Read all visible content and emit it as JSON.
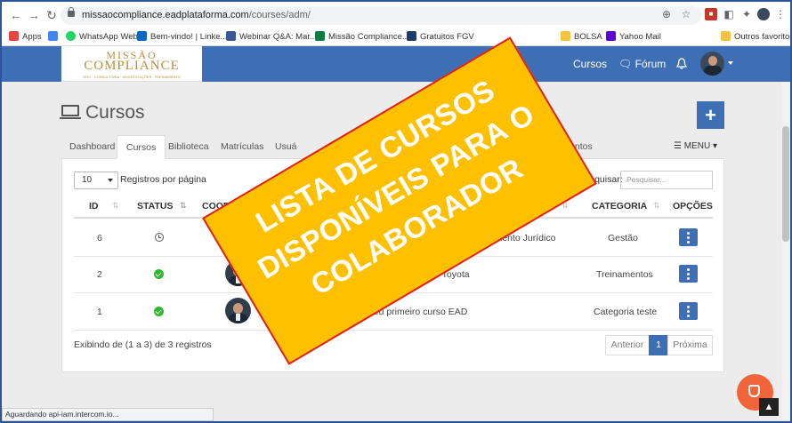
{
  "browser": {
    "url_host": "missaocompliance.eadplataforma.com",
    "url_path": "/courses/adm/",
    "bookmarks": [
      {
        "label": "Apps",
        "color": "#e8453c"
      },
      {
        "label": "",
        "color": "#4285f4"
      },
      {
        "label": "WhatsApp Web",
        "color": "#25d366"
      },
      {
        "label": "Bem-vindo! | Linke...",
        "color": "#0a66c2"
      },
      {
        "label": "Webinar Q&A: Mar...",
        "color": "#3b5998"
      },
      {
        "label": "Missão Compliance...",
        "color": "#107c41"
      },
      {
        "label": "Gratuitos FGV",
        "color": "#1d3c6e"
      },
      {
        "label": "BOLSA",
        "color": "#f5c242"
      },
      {
        "label": "Yahoo Mail",
        "color": "#6001d2"
      },
      {
        "label": "Outros favoritos",
        "color": "#f5c242"
      }
    ],
    "status": "Aguardando api-iam.intercom.io..."
  },
  "header": {
    "logo_top": "MISSÃO",
    "logo_main": "COMPLIANCE",
    "logo_sub": "GRC · CONSULTORIA · INVESTIGAÇÕES · TREINAMENTO",
    "courses_link": "Cursos",
    "forum_link": "Fórum"
  },
  "page": {
    "title": "Cursos",
    "add_button": "+",
    "tabs": [
      "Dashboard",
      "Cursos",
      "Biblioteca",
      "Matrículas",
      "Usuá",
      "imentos"
    ],
    "menu_label": "MENU"
  },
  "table": {
    "per_page": "10",
    "per_page_label": "Registros por página",
    "search_label": "Pesquisar:",
    "search_placeholder": "Pesquisar...",
    "headers": {
      "id": "ID",
      "status": "STATUS",
      "coord": "COORDE",
      "category": "CATEGORIA",
      "options": "OPÇÕES"
    },
    "rows": [
      {
        "id": "6",
        "status": "pending",
        "count": "",
        "course": "s de Gestão para o Departamento Jurídico",
        "category": "Gestão"
      },
      {
        "id": "2",
        "status": "active",
        "count": "",
        "course": "Compliance - Grupo Toyota",
        "category": "Treinamentos"
      },
      {
        "id": "1",
        "status": "active",
        "count": "2",
        "course": "Meu primeiro curso EAD",
        "category": "Categoria teste"
      }
    ],
    "footer": "Exibindo de (1 a 3) de 3 registros",
    "pager": {
      "prev": "Anterior",
      "current": "1",
      "next": "Próxima"
    }
  },
  "banner": {
    "lines": [
      "LISTA DE CURSOS",
      "DISPONÍVEIS PARA O",
      "COLABORADOR"
    ],
    "fill": "#ffc000",
    "border": "#e02020"
  }
}
